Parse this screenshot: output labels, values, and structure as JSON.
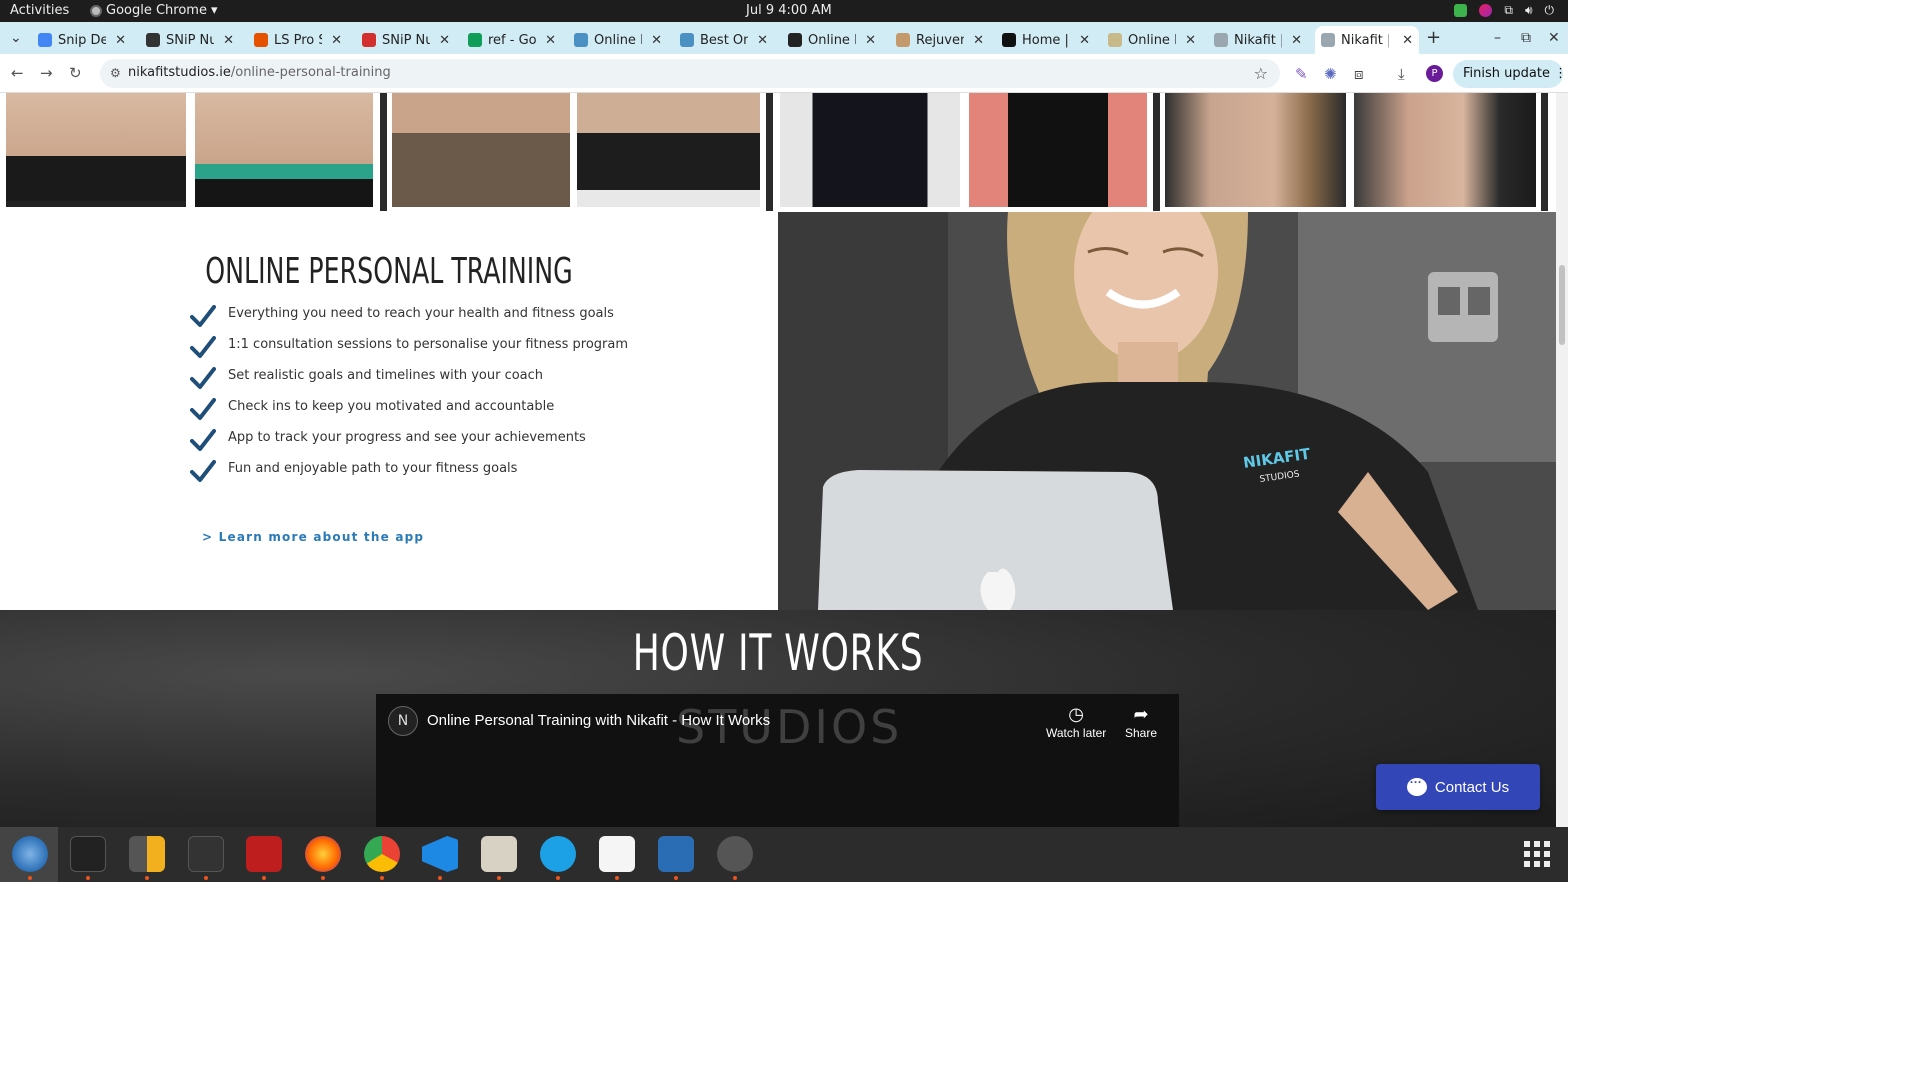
{
  "topbar": {
    "activities": "Activities",
    "app_name": "Google Chrome",
    "clock": "Jul 9  4:00 AM"
  },
  "tabs": [
    {
      "label": "Snip Det",
      "color": "#4285f4"
    },
    {
      "label": "SNiP Nut",
      "color": "#333333"
    },
    {
      "label": "LS Pro Sy",
      "color": "#e65100"
    },
    {
      "label": "SNiP Nut",
      "color": "#d32f2f"
    },
    {
      "label": "ref - Goo",
      "color": "#0f9d58"
    },
    {
      "label": "Online Fi",
      "color": "#4a90c2"
    },
    {
      "label": "Best Onl",
      "color": "#4a90c2"
    },
    {
      "label": "Online Fi",
      "color": "#222222"
    },
    {
      "label": "Rejuven",
      "color": "#c49a6c"
    },
    {
      "label": "Home | D",
      "color": "#111111"
    },
    {
      "label": "Online P",
      "color": "#c8b98a"
    },
    {
      "label": "Nikafit |",
      "color": "#9aa7b0"
    },
    {
      "label": "Nikafit |",
      "color": "#9aa7b0"
    }
  ],
  "toolbar": {
    "url_domain": "nikafitstudios.ie",
    "url_path": "/online-personal-training",
    "finish_update": "Finish update",
    "profile_initial": "P"
  },
  "page": {
    "opt_title": "ONLINE PERSONAL TRAINING",
    "features": [
      "Everything you need to reach your health and fitness goals",
      "1:1 consultation sessions to personalise your fitness program",
      "Set realistic goals and timelines with your coach",
      "Check ins to keep you motivated and accountable",
      "App to track your progress and see your achievements",
      "Fun and enjoyable path to your fitness goals"
    ],
    "learn_more": "> Learn more about the app",
    "shirt_brand": "NIKAFIT",
    "shirt_sub": "STUDIOS",
    "how_title": "HOW IT WORKS",
    "video": {
      "title": "Online Personal Training with Nikafit - How It Works",
      "watch_later": "Watch later",
      "share": "Share",
      "bg_text": "STUDIOS",
      "channel_initial": "N"
    },
    "contact": "Contact Us"
  },
  "colors": {
    "accent": "#2a7ab8",
    "check": "#1f4e79",
    "contact_bg": "#3346b8",
    "tab_strip": "#d1ecf5"
  }
}
